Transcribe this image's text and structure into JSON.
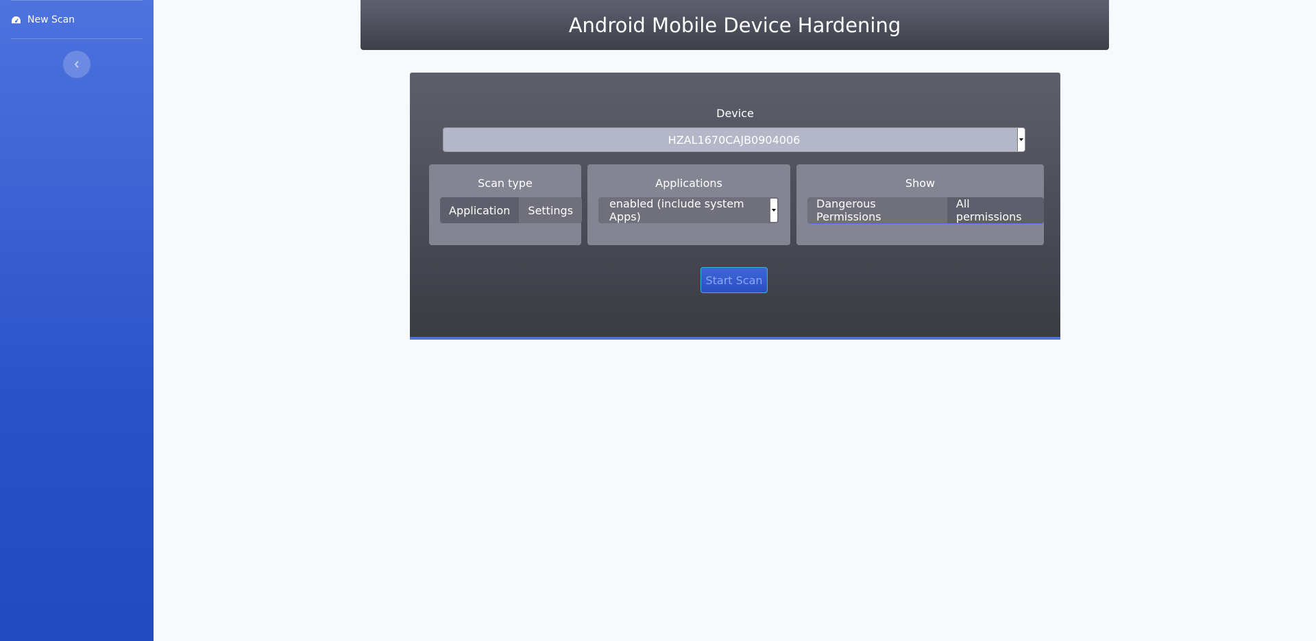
{
  "sidebar": {
    "nav_item_label": "New Scan",
    "toggle_icon": "chevron-left-icon"
  },
  "header": {
    "title": "Android Mobile Device Hardening"
  },
  "form": {
    "device_label": "Device",
    "device_value": "HZAL1670CAJB0904006",
    "scan_type": {
      "title": "Scan type",
      "options": [
        "Application",
        "Settings"
      ],
      "selected": "Application"
    },
    "applications": {
      "title": "Applications",
      "value": "enabled (include system Apps)"
    },
    "show": {
      "title": "Show",
      "options": [
        "Dangerous Permissions",
        "All permissions"
      ],
      "selected": "All permissions"
    },
    "start_label": "Start Scan"
  },
  "colors": {
    "sidebar_accent": "#4e73df",
    "button_border": "#36b9cc"
  }
}
